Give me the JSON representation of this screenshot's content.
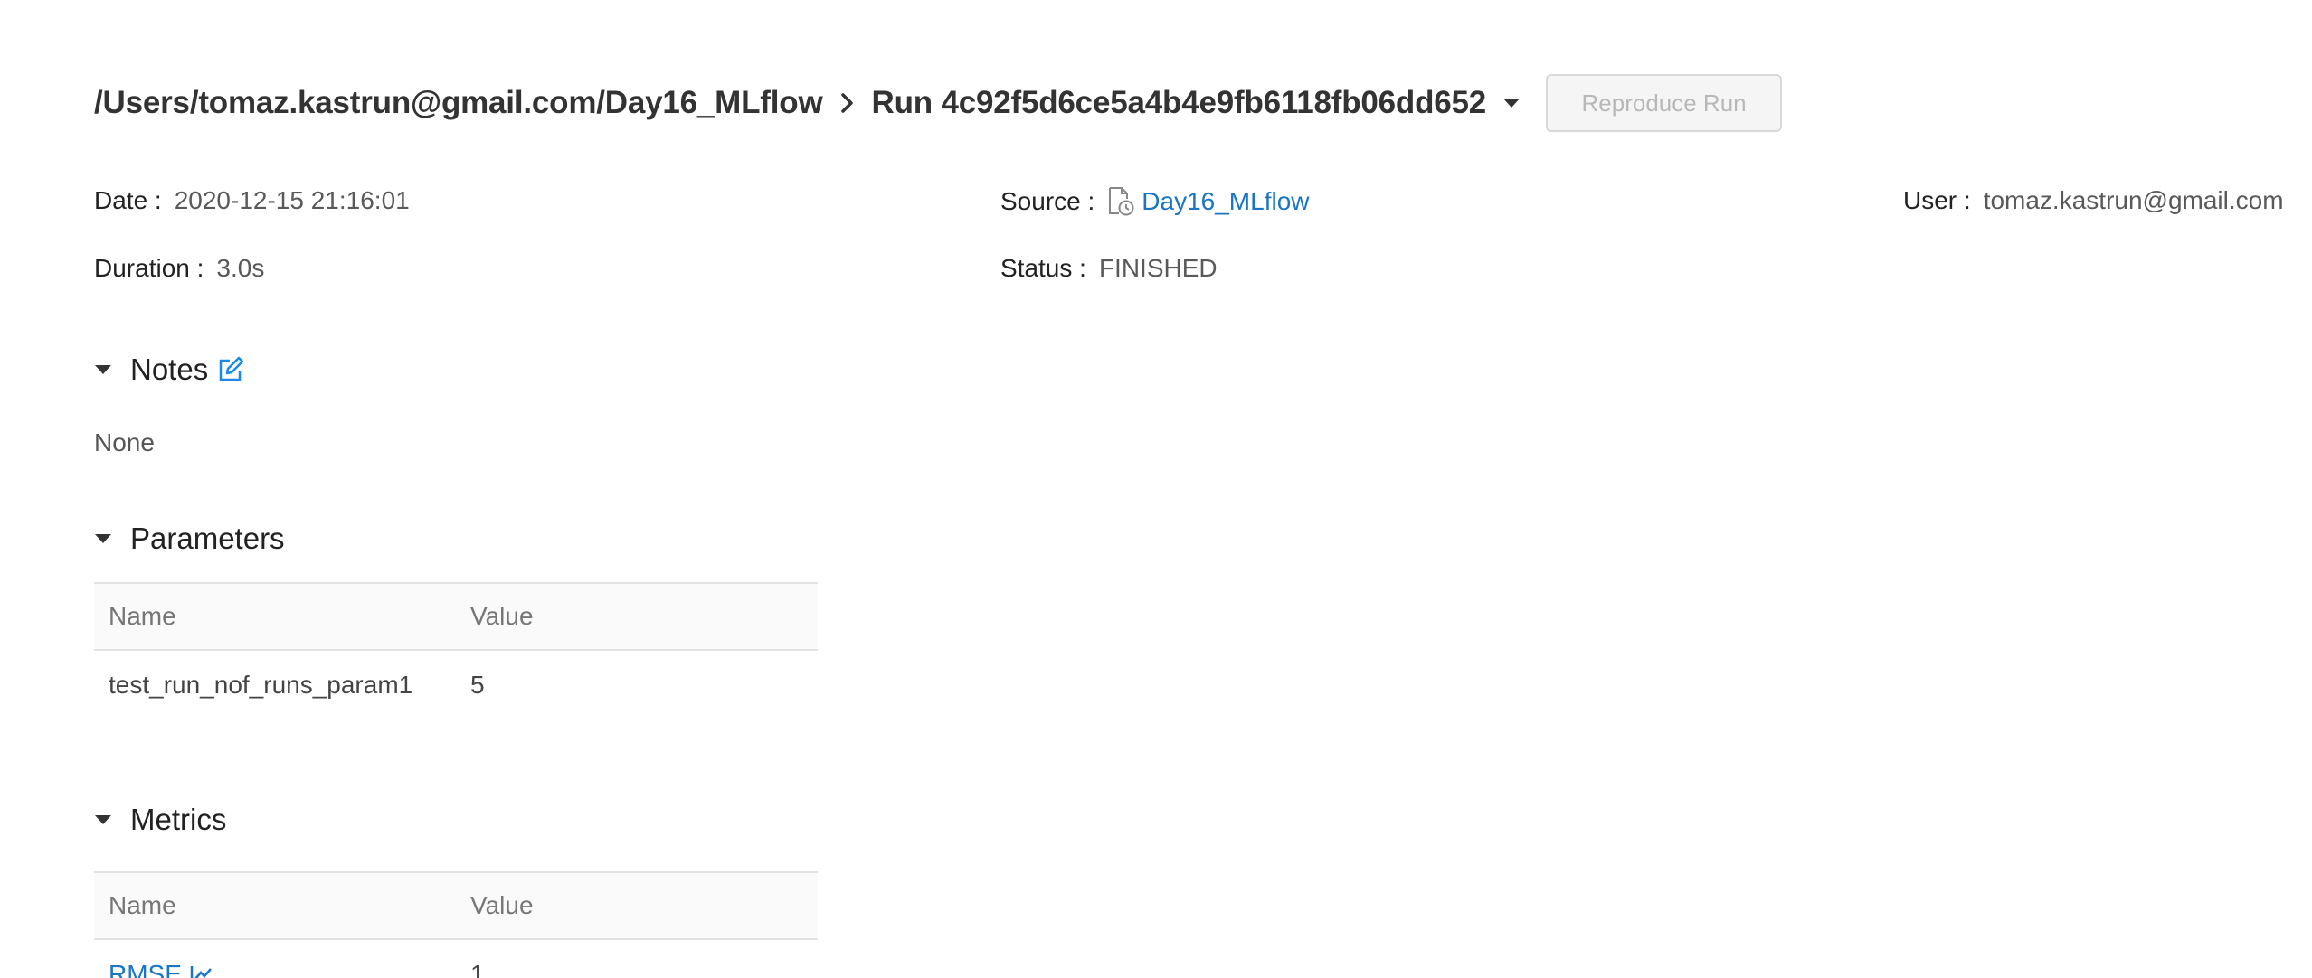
{
  "header": {
    "experiment_path": "/Users/tomaz.kastrun@gmail.com/Day16_MLflow",
    "run_title": "Run 4c92f5d6ce5a4b4e9fb6118fb06dd652",
    "reproduce_label": "Reproduce Run"
  },
  "meta": {
    "date_label": "Date",
    "date_value": "2020-12-15 21:16:01",
    "source_label": "Source",
    "source_value": "Day16_MLflow",
    "user_label": "User",
    "user_value": "tomaz.kastrun@gmail.com",
    "duration_label": "Duration",
    "duration_value": "3.0s",
    "status_label": "Status",
    "status_value": "FINISHED"
  },
  "notes": {
    "title": "Notes",
    "content": "None"
  },
  "parameters": {
    "title": "Parameters",
    "columns": [
      "Name",
      "Value"
    ],
    "rows": [
      {
        "name": "test_run_nof_runs_param1",
        "value": "5"
      }
    ]
  },
  "metrics": {
    "title": "Metrics",
    "columns": [
      "Name",
      "Value"
    ],
    "rows": [
      {
        "name": "RMSE",
        "value": "1"
      }
    ]
  },
  "colors": {
    "link": "#1a75c2",
    "text": "#333333",
    "muted": "#595959",
    "table_header_bg": "#fafafa"
  }
}
